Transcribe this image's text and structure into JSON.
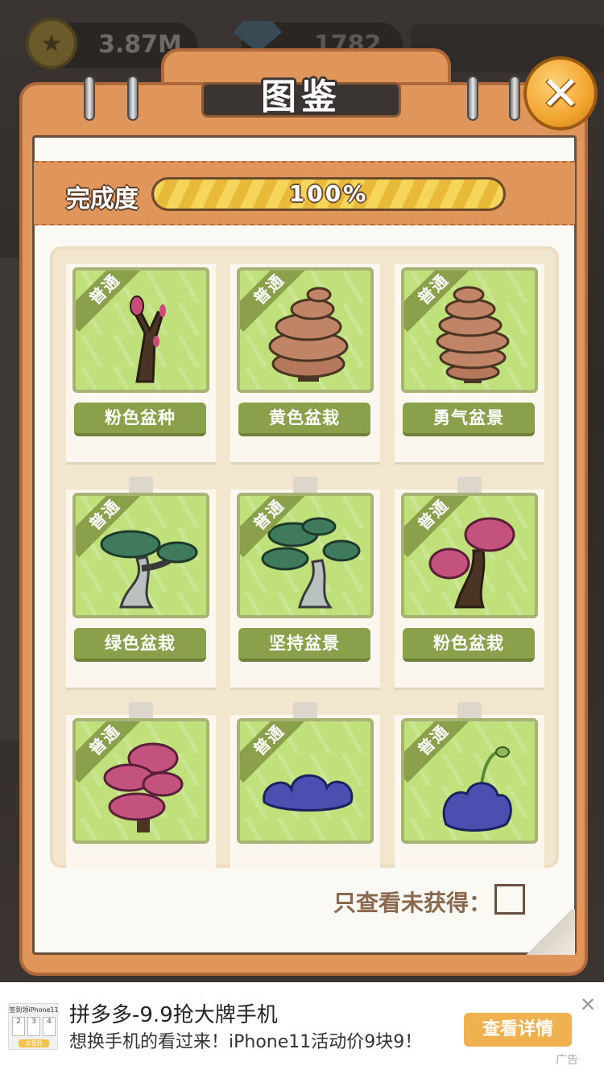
{
  "hud": {
    "coins": "3.87M",
    "gems": "1782"
  },
  "panel": {
    "title": "图鉴",
    "close_icon": "close-icon",
    "progress_label": "完成度",
    "progress_value": "100%",
    "progress_fraction": 1.0,
    "filter_label": "只查看未获得："
  },
  "cards": [
    {
      "rarity": "普通",
      "name": "粉色盆种",
      "plant": "bare-branch-pink-buds"
    },
    {
      "rarity": "普通",
      "name": "黄色盆栽",
      "plant": "brown-mushroom-stack"
    },
    {
      "rarity": "普通",
      "name": "勇气盆景",
      "plant": "tall-mushroom-stack"
    },
    {
      "rarity": "普通",
      "name": "绿色盆栽",
      "plant": "green-bonsai"
    },
    {
      "rarity": "普通",
      "name": "坚持盆景",
      "plant": "green-bonsai-large"
    },
    {
      "rarity": "普通",
      "name": "粉色盆栽",
      "plant": "pink-blossom-tree"
    },
    {
      "rarity": "普通",
      "name": "",
      "plant": "pink-cloud-tree"
    },
    {
      "rarity": "普通",
      "name": "",
      "plant": "blue-succulent-bush"
    },
    {
      "rarity": "普通",
      "name": "",
      "plant": "blue-succulent-sprout"
    }
  ],
  "ad": {
    "title": "拼多多-9.9抢大牌手机",
    "description": "想换手机的看过来！iPhone11活动价9块9！",
    "cta": "查看详情",
    "tag": "广告",
    "thumb_title": "签到领iPhone11",
    "thumb_cells": [
      "2",
      "3",
      "4"
    ],
    "thumb_button": "去签到"
  },
  "colors": {
    "panel_orange": "#e0955a",
    "card_green": "#8aa04a",
    "progress_yellow": "#f6d65a",
    "close_gold": "#f2a52e"
  }
}
